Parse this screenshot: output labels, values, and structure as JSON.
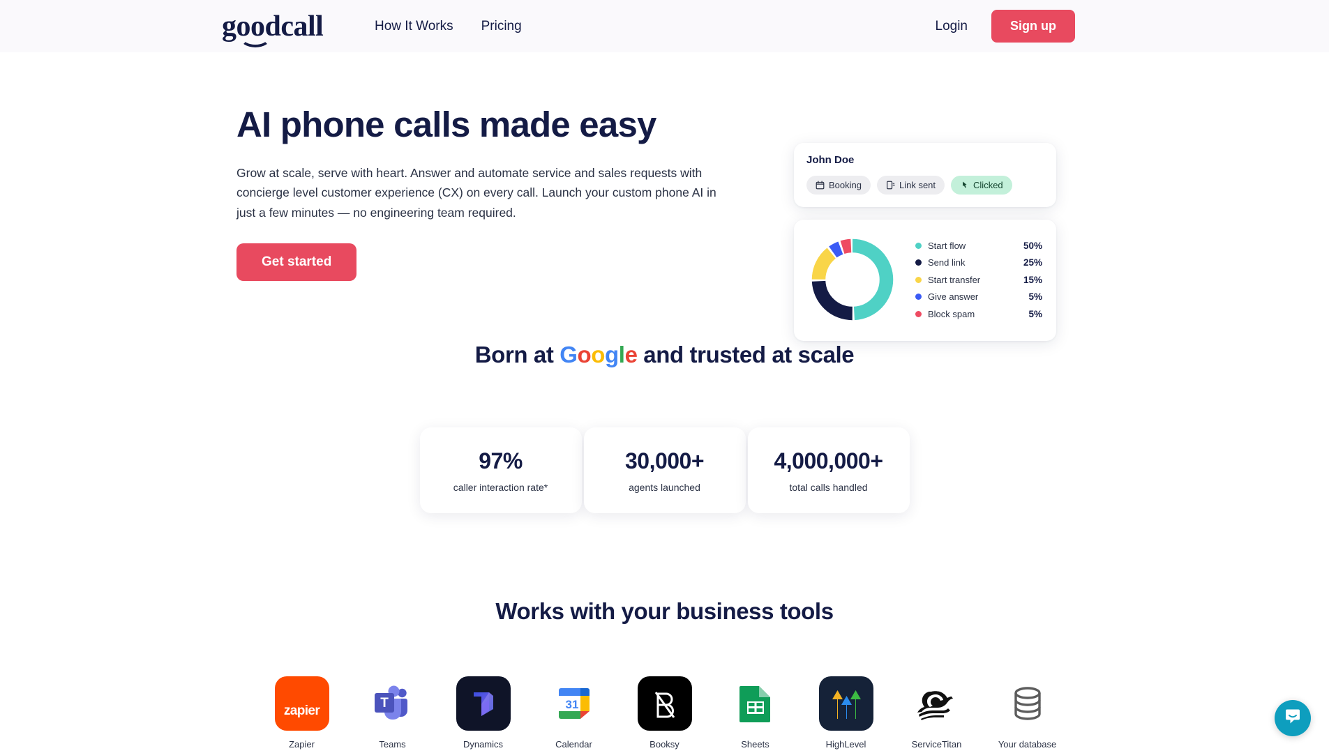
{
  "theme": {
    "brand_navy": "#141B45",
    "brand_red": "#E84A5F",
    "header_bg": "#FAF9FC",
    "page_bg": "#FFFFFF",
    "chat_teal": "#0E9EBE"
  },
  "header": {
    "logo_text": "goodcall",
    "nav": [
      {
        "label": "How It Works"
      },
      {
        "label": "Pricing"
      }
    ],
    "login_label": "Login",
    "signup_label": "Sign up"
  },
  "hero": {
    "title": "AI phone calls made easy",
    "subtitle": "Grow at scale, serve with heart. Answer and automate service and sales requests with concierge level customer experience (CX) on every call. Launch your custom phone AI in just a few minutes — no engineering team required.",
    "cta_label": "Get started"
  },
  "hero_card": {
    "contact_name": "John Doe",
    "badges": [
      {
        "label": "Booking",
        "icon": "calendar-icon",
        "style": "gray"
      },
      {
        "label": "Link sent",
        "icon": "mobile-icon",
        "style": "gray"
      },
      {
        "label": "Clicked",
        "icon": "cursor-icon",
        "style": "green"
      }
    ]
  },
  "chart_data": {
    "type": "pie",
    "title": "",
    "subtype": "donut",
    "legend_position": "right",
    "categories": [
      "Start flow",
      "Send link",
      "Start transfer",
      "Give answer",
      "Block spam"
    ],
    "values": [
      50,
      25,
      15,
      5,
      5
    ],
    "value_labels": [
      "50%",
      "25%",
      "15%",
      "5%",
      "5%"
    ],
    "colors": [
      "#4FD1C5",
      "#141B45",
      "#F9D548",
      "#3B5BF5",
      "#EE4B62"
    ],
    "unit": "%",
    "start_angle_deg": 0,
    "direction": "clockwise"
  },
  "google_section": {
    "prefix": "Born at ",
    "google_letters": [
      {
        "char": "G",
        "color": "#4285F4"
      },
      {
        "char": "o",
        "color": "#EA4335"
      },
      {
        "char": "o",
        "color": "#FBBC05"
      },
      {
        "char": "g",
        "color": "#4285F4"
      },
      {
        "char": "l",
        "color": "#34A853"
      },
      {
        "char": "e",
        "color": "#EA4335"
      }
    ],
    "suffix": " and trusted at scale"
  },
  "stats": [
    {
      "value": "97%",
      "label": "caller interaction rate*"
    },
    {
      "value": "30,000+",
      "label": "agents launched"
    },
    {
      "value": "4,000,000+",
      "label": "total calls handled"
    }
  ],
  "tools_section": {
    "heading": "Works with your business tools",
    "tools": [
      {
        "name": "Zapier",
        "icon": "zapier-icon",
        "label": "Zapier"
      },
      {
        "name": "Teams",
        "icon": "ms-teams-icon",
        "label": "Teams"
      },
      {
        "name": "Dynamics",
        "icon": "ms-dynamics-icon",
        "label": "Dynamics"
      },
      {
        "name": "Calendar",
        "icon": "google-calendar-icon",
        "label": "Calendar"
      },
      {
        "name": "Booksy",
        "icon": "booksy-icon",
        "label": "Booksy"
      },
      {
        "name": "Sheets",
        "icon": "google-sheets-icon",
        "label": "Sheets"
      },
      {
        "name": "HighLevel",
        "icon": "highlevel-icon",
        "label": "HighLevel"
      },
      {
        "name": "Service Titan",
        "icon": "servicetitan-icon",
        "label": "ServiceTitan"
      },
      {
        "name": "Your database",
        "icon": "database-icon",
        "label": "Your database"
      }
    ]
  },
  "chat_widget": {
    "icon": "chat-bubble-smile-icon",
    "aria_label": "Open chat"
  }
}
